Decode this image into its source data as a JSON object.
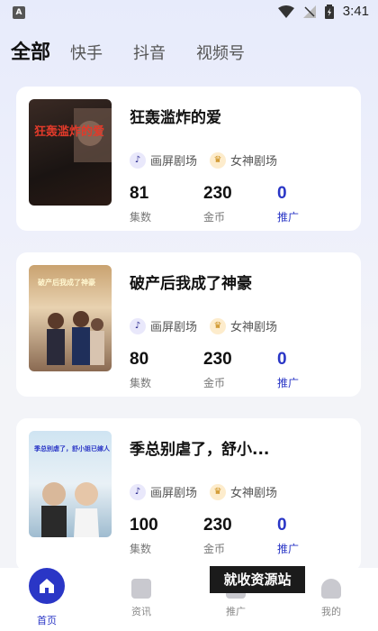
{
  "status_bar": {
    "time": "3:41",
    "app_icon_letter": "A"
  },
  "tabs": [
    {
      "label": "全部",
      "active": true
    },
    {
      "label": "快手",
      "active": false
    },
    {
      "label": "抖音",
      "active": false
    },
    {
      "label": "视频号",
      "active": false
    }
  ],
  "cards": [
    {
      "title": "狂轰滥炸的爱",
      "poster_text": "狂轰滥炸的爱",
      "tags": [
        {
          "icon": "tiktok-icon",
          "label": "画屏剧场"
        },
        {
          "icon": "goddess-icon",
          "label": "女神剧场"
        }
      ],
      "episodes": "81",
      "episodes_label": "集数",
      "coins": "230",
      "coins_label": "金币",
      "promo": "0",
      "promo_label": "推广"
    },
    {
      "title": "破产后我成了神豪",
      "poster_text": "破产后我成了神豪",
      "tags": [
        {
          "icon": "tiktok-icon",
          "label": "画屏剧场"
        },
        {
          "icon": "goddess-icon",
          "label": "女神剧场"
        }
      ],
      "episodes": "80",
      "episodes_label": "集数",
      "coins": "230",
      "coins_label": "金币",
      "promo": "0",
      "promo_label": "推广"
    },
    {
      "title": "季总别虐了，舒小...",
      "poster_text": "季总别虐了，舒小姐已嫁人",
      "tags": [
        {
          "icon": "tiktok-icon",
          "label": "画屏剧场"
        },
        {
          "icon": "goddess-icon",
          "label": "女神剧场"
        }
      ],
      "episodes": "100",
      "episodes_label": "集数",
      "coins": "230",
      "coins_label": "金币",
      "promo": "0",
      "promo_label": "推广"
    }
  ],
  "bottom_nav": [
    {
      "label": "首页",
      "icon": "home-icon",
      "active": true
    },
    {
      "label": "资讯",
      "icon": "news-icon",
      "active": false
    },
    {
      "label": "推广",
      "icon": "promote-icon",
      "active": false
    },
    {
      "label": "我的",
      "icon": "profile-icon",
      "active": false
    }
  ],
  "watermark": "就收资源站",
  "colors": {
    "accent": "#2a36c6",
    "background": "#f3f4f8",
    "card": "#ffffff"
  }
}
